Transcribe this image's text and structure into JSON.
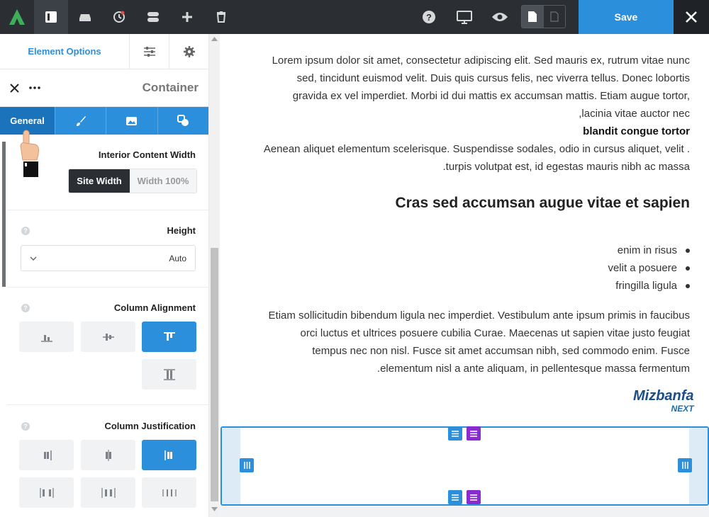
{
  "topbar": {
    "save_label": "Save",
    "colors": {
      "bar": "#2b2f33",
      "save": "#2c8fdb"
    }
  },
  "panel": {
    "tab_element_options": "Element Options",
    "header_title": "Container",
    "subtabs": {
      "general": "General"
    },
    "interior_content_width": {
      "label": "Interior Content Width",
      "options": [
        "Site Width",
        "Width 100%"
      ],
      "selected": "Site Width"
    },
    "height": {
      "label": "Height",
      "value": "Auto"
    },
    "column_alignment": {
      "label": "Column Alignment",
      "selected": "top"
    },
    "column_justification": {
      "label": "Column Justification",
      "selected": "start"
    }
  },
  "content": {
    "para1_lines": [
      "Lorem ipsum dolor sit amet, consectetur adipiscing elit. Sed mauris ex, rutrum vitae nunc",
      "sed, tincidunt euismod velit. Duis quis cursus felis, nec viverra tellus. Donec lobortis",
      "gravida ex vel imperdiet. Morbi id dui mattis ex accumsan mattis. Etiam augue tortor,",
      ",lacinia vitae auctor nec"
    ],
    "bold_line": "blandit congue tortor",
    "para2_lines": [
      "Aenean aliquet elementum scelerisque. Suspendisse sodales, odio in cursus aliquet, velit .",
      ".turpis volutpat est, id egestas mauris nibh ac massa"
    ],
    "heading": "Cras sed accumsan augue vitae et sapien",
    "list": [
      "enim in risus",
      "velit a posuere",
      "fringilla ligula"
    ],
    "para3_lines": [
      "Etiam sollicitudin bibendum ligula nec imperdiet. Vestibulum ante ipsum primis in faucibus",
      "orci luctus et ultrices posuere cubilia Curae. Maecenas ut sapien vitae justo feugiat",
      "tempus nec non nisl. Fusce sit amet accumsan nibh, sed commodo enim. Fusce",
      ".elementum nisl a ante aliquam, in pellentesque massa fermentum"
    ]
  },
  "watermark": {
    "line1": "Mizbanfa",
    "line2": "NEXT"
  }
}
